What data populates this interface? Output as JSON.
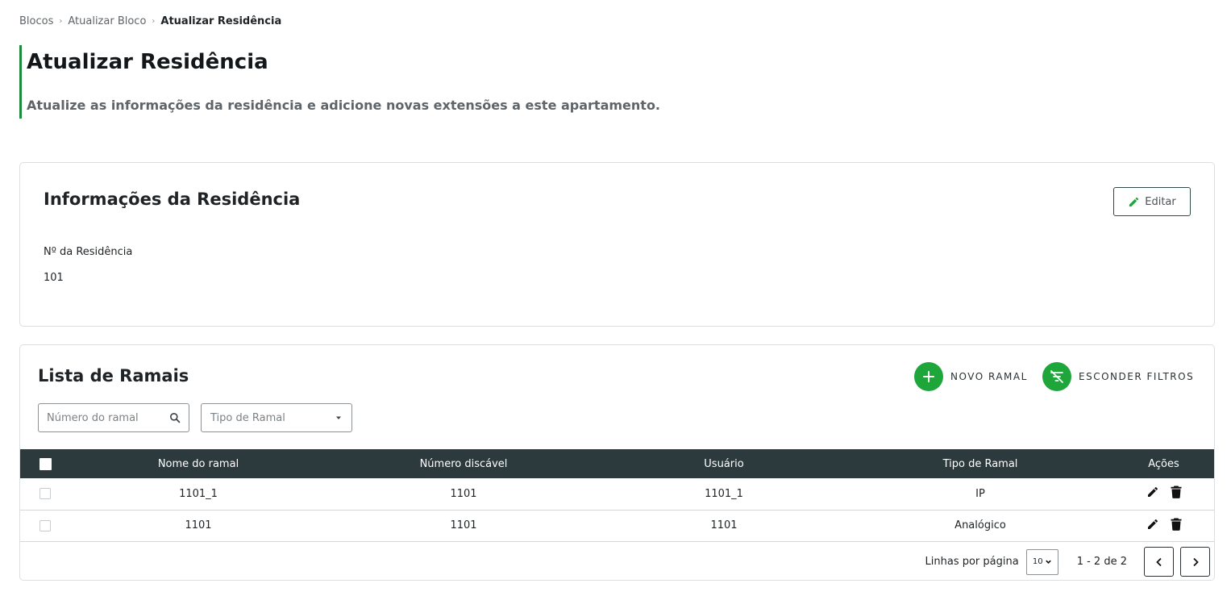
{
  "breadcrumb": [
    "Blocos",
    "Atualizar Bloco",
    "Atualizar Residência"
  ],
  "header": {
    "title": "Atualizar Residência",
    "subtitle": "Atualize as informações da residência e adicione novas extensões a este apartamento."
  },
  "info_card": {
    "title": "Informações da Residência",
    "edit_label": "Editar",
    "field_label": "Nº da Residência",
    "field_value": "101"
  },
  "list_card": {
    "title": "Lista de Ramais",
    "new_button": "NOVO RAMAL",
    "filters_button": "ESCONDER FILTROS",
    "search_placeholder": "Número do ramal",
    "type_placeholder": "Tipo de Ramal",
    "columns": [
      "Nome do ramal",
      "Número discável",
      "Usuário",
      "Tipo de Ramal",
      "Ações"
    ],
    "rows": [
      {
        "name": "1101_1",
        "number": "1101",
        "user": "1101_1",
        "type": "IP"
      },
      {
        "name": "1101",
        "number": "1101",
        "user": "1101",
        "type": "Analógico"
      }
    ],
    "pagination": {
      "rows_label": "Linhas por página",
      "rows_value": "10",
      "range": "1 - 2 de 2"
    }
  },
  "icons": {
    "edit": "pencil-icon",
    "delete": "trash-icon",
    "search": "search-icon",
    "add": "plus-icon",
    "filters": "filter-off-icon",
    "dropdown": "caret-down-icon",
    "prev": "chevron-left-icon",
    "next": "chevron-right-icon"
  },
  "colors": {
    "accent": "#1ea63a",
    "header_bar": "#1e8a3c",
    "table_header": "#2d3a3d"
  }
}
